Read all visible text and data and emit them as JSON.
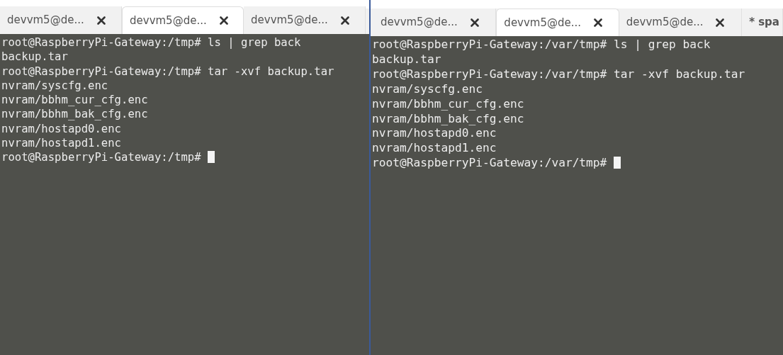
{
  "panes": [
    {
      "tabs": [
        {
          "label": "devvm5@de...",
          "selected": false,
          "closable": true
        },
        {
          "label": "devvm5@de...",
          "selected": true,
          "closable": true
        },
        {
          "label": "devvm5@de...",
          "selected": false,
          "closable": true
        }
      ],
      "lines": [
        "root@RaspberryPi-Gateway:/tmp# ls | grep back",
        "backup.tar",
        "root@RaspberryPi-Gateway:/tmp# tar -xvf backup.tar",
        "nvram/syscfg.enc",
        "nvram/bbhm_cur_cfg.enc",
        "nvram/bbhm_bak_cfg.enc",
        "nvram/hostapd0.enc",
        "nvram/hostapd1.enc",
        "root@RaspberryPi-Gateway:/tmp#"
      ],
      "cursor": true
    },
    {
      "tabs": [
        {
          "label": "devvm5@de...",
          "selected": false,
          "closable": true
        },
        {
          "label": "devvm5@de...",
          "selected": true,
          "closable": true
        },
        {
          "label": "devvm5@de...",
          "selected": false,
          "closable": true
        },
        {
          "label": "* spa",
          "selected": false,
          "closable": false
        }
      ],
      "lines": [
        "root@RaspberryPi-Gateway:/var/tmp# ls | grep back",
        "backup.tar",
        "root@RaspberryPi-Gateway:/var/tmp# tar -xvf backup.tar",
        "nvram/syscfg.enc",
        "nvram/bbhm_cur_cfg.enc",
        "nvram/bbhm_bak_cfg.enc",
        "nvram/hostapd0.enc",
        "nvram/hostapd1.enc",
        "root@RaspberryPi-Gateway:/var/tmp#"
      ],
      "cursor": true
    }
  ]
}
